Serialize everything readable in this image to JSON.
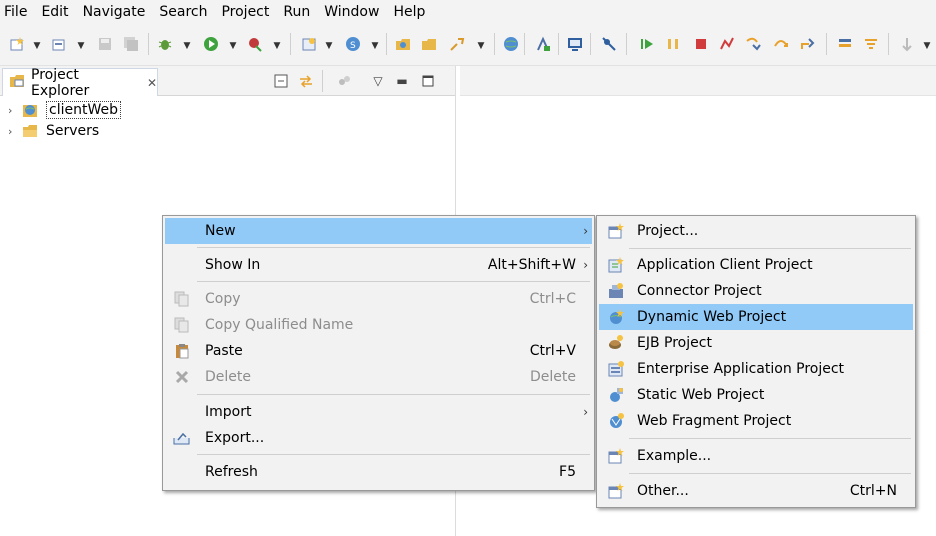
{
  "menubar": {
    "items": [
      "File",
      "Edit",
      "Navigate",
      "Search",
      "Project",
      "Run",
      "Window",
      "Help"
    ]
  },
  "toolbar": {
    "icons": [
      "new-wizard-icon",
      "new-server-icon",
      "save-icon",
      "save-all-icon",
      "debug-icon",
      "run-icon",
      "external-tools-icon",
      "new-java-class-icon",
      "new-package-icon",
      "open-type-icon",
      "open-task-icon",
      "search-icon",
      "globe-icon",
      "ant-icon",
      "console-icon",
      "skip-breakpoints-icon",
      "resume-icon",
      "suspend-icon",
      "terminate-icon",
      "disconnect-icon",
      "step-into-icon",
      "step-over-icon",
      "step-return-icon",
      "drop-to-frame-icon",
      "use-step-filters-icon",
      "pin-icon"
    ]
  },
  "project_explorer": {
    "tab_label": "Project Explorer",
    "tree": [
      {
        "label": "clientWeb",
        "icon": "web-project-icon",
        "selected": true
      },
      {
        "label": "Servers",
        "icon": "folder-icon",
        "selected": false
      }
    ]
  },
  "context_menu": {
    "items": [
      {
        "label": "New",
        "shortcut": "",
        "submenu": true,
        "enabled": true,
        "highlighted": true,
        "icon": ""
      },
      {
        "label": "Show In",
        "shortcut": "Alt+Shift+W",
        "submenu": true,
        "enabled": true,
        "highlighted": false,
        "icon": ""
      },
      {
        "label": "Copy",
        "shortcut": "Ctrl+C",
        "submenu": false,
        "enabled": false,
        "highlighted": false,
        "icon": "copy-icon"
      },
      {
        "label": "Copy Qualified Name",
        "shortcut": "",
        "submenu": false,
        "enabled": false,
        "highlighted": false,
        "icon": "copy-qualified-icon"
      },
      {
        "label": "Paste",
        "shortcut": "Ctrl+V",
        "submenu": false,
        "enabled": true,
        "highlighted": false,
        "icon": "paste-icon"
      },
      {
        "label": "Delete",
        "shortcut": "Delete",
        "submenu": false,
        "enabled": false,
        "highlighted": false,
        "icon": "delete-icon"
      },
      {
        "label": "Import",
        "shortcut": "",
        "submenu": true,
        "enabled": true,
        "highlighted": false,
        "icon": ""
      },
      {
        "label": "Export...",
        "shortcut": "",
        "submenu": false,
        "enabled": true,
        "highlighted": false,
        "icon": "export-icon"
      },
      {
        "label": "Refresh",
        "shortcut": "F5",
        "submenu": false,
        "enabled": true,
        "highlighted": false,
        "icon": ""
      }
    ]
  },
  "new_submenu": {
    "items": [
      {
        "label": "Project...",
        "shortcut": "",
        "icon": "new-project-icon",
        "highlighted": false
      },
      {
        "label": "Application Client Project",
        "shortcut": "",
        "icon": "app-client-project-icon",
        "highlighted": false
      },
      {
        "label": "Connector Project",
        "shortcut": "",
        "icon": "connector-project-icon",
        "highlighted": false
      },
      {
        "label": "Dynamic Web Project",
        "shortcut": "",
        "icon": "dynamic-web-project-icon",
        "highlighted": true
      },
      {
        "label": "EJB Project",
        "shortcut": "",
        "icon": "ejb-project-icon",
        "highlighted": false
      },
      {
        "label": "Enterprise Application Project",
        "shortcut": "",
        "icon": "ear-project-icon",
        "highlighted": false
      },
      {
        "label": "Static Web Project",
        "shortcut": "",
        "icon": "static-web-project-icon",
        "highlighted": false
      },
      {
        "label": "Web Fragment Project",
        "shortcut": "",
        "icon": "web-fragment-project-icon",
        "highlighted": false
      },
      {
        "label": "Example...",
        "shortcut": "",
        "icon": "example-icon",
        "highlighted": false
      },
      {
        "label": "Other...",
        "shortcut": "Ctrl+N",
        "icon": "other-wizard-icon",
        "highlighted": false
      }
    ]
  },
  "colors": {
    "highlight": "#91c9f7",
    "submenu_highlight": "#91c9f7",
    "disabled_text": "#8d8d8d",
    "menu_bg": "#f2f2f2"
  }
}
